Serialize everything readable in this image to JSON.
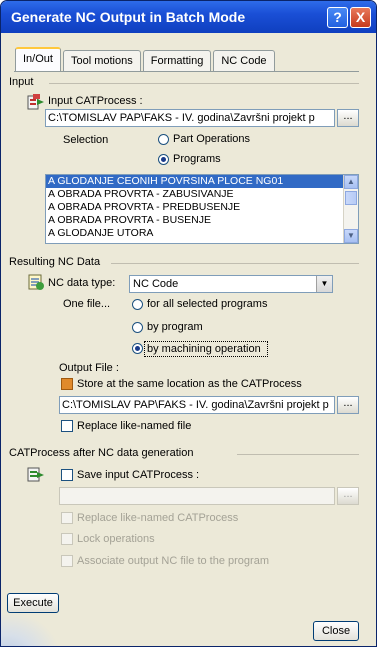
{
  "window": {
    "title": "Generate NC Output in Batch Mode",
    "help_glyph": "?",
    "close_glyph": "X"
  },
  "tabs": [
    {
      "label": "In/Out"
    },
    {
      "label": "Tool motions"
    },
    {
      "label": "Formatting"
    },
    {
      "label": "NC Code"
    }
  ],
  "input": {
    "group_label": "Input",
    "catprocess_label": "Input CATProcess :",
    "catprocess_path": "C:\\TOMISLAV PAP\\FAKS - IV. godina\\Završni projekt p",
    "browse_label": "...",
    "selection_label": "Selection",
    "option_part_operations": "Part Operations",
    "option_programs": "Programs",
    "programs": [
      "A GLODANJE CEONIH POVRSINA PLOCE NG01",
      "A OBRADA PROVRTA - ZABUSIVANJE",
      "A OBRADA PROVRTA - PREDBUSENJE",
      "A OBRADA PROVRTA - BUSENJE",
      "A GLODANJE UTORA"
    ]
  },
  "resulting": {
    "group_label": "Resulting NC Data",
    "nc_data_type_label": "NC data type:",
    "nc_data_type_value": "NC Code",
    "one_file_label": "One file...",
    "option_all_programs": "for all selected programs",
    "option_by_program": "by program",
    "option_by_operation": "by machining operation",
    "output_file_label": "Output File :",
    "store_same_location": "Store at the same location as the CATProcess",
    "output_path": "C:\\TOMISLAV PAP\\FAKS - IV. godina\\Završni projekt p",
    "browse_label": "...",
    "replace_like_named": "Replace like-named file"
  },
  "after": {
    "group_label": "CATProcess after NC data generation",
    "save_input": "Save input CATProcess :",
    "save_path": "",
    "browse_label": "...",
    "replace_like_named_catprocess": "Replace like-named CATProcess",
    "lock_operations": "Lock operations",
    "associate_output": "Associate output NC file to the program"
  },
  "buttons": {
    "execute": "Execute",
    "close": "Close"
  },
  "colors": {
    "title_bar": "#1a4fd6",
    "selection_highlight": "#316ac5",
    "dialog_bg": "#ece9d8"
  }
}
